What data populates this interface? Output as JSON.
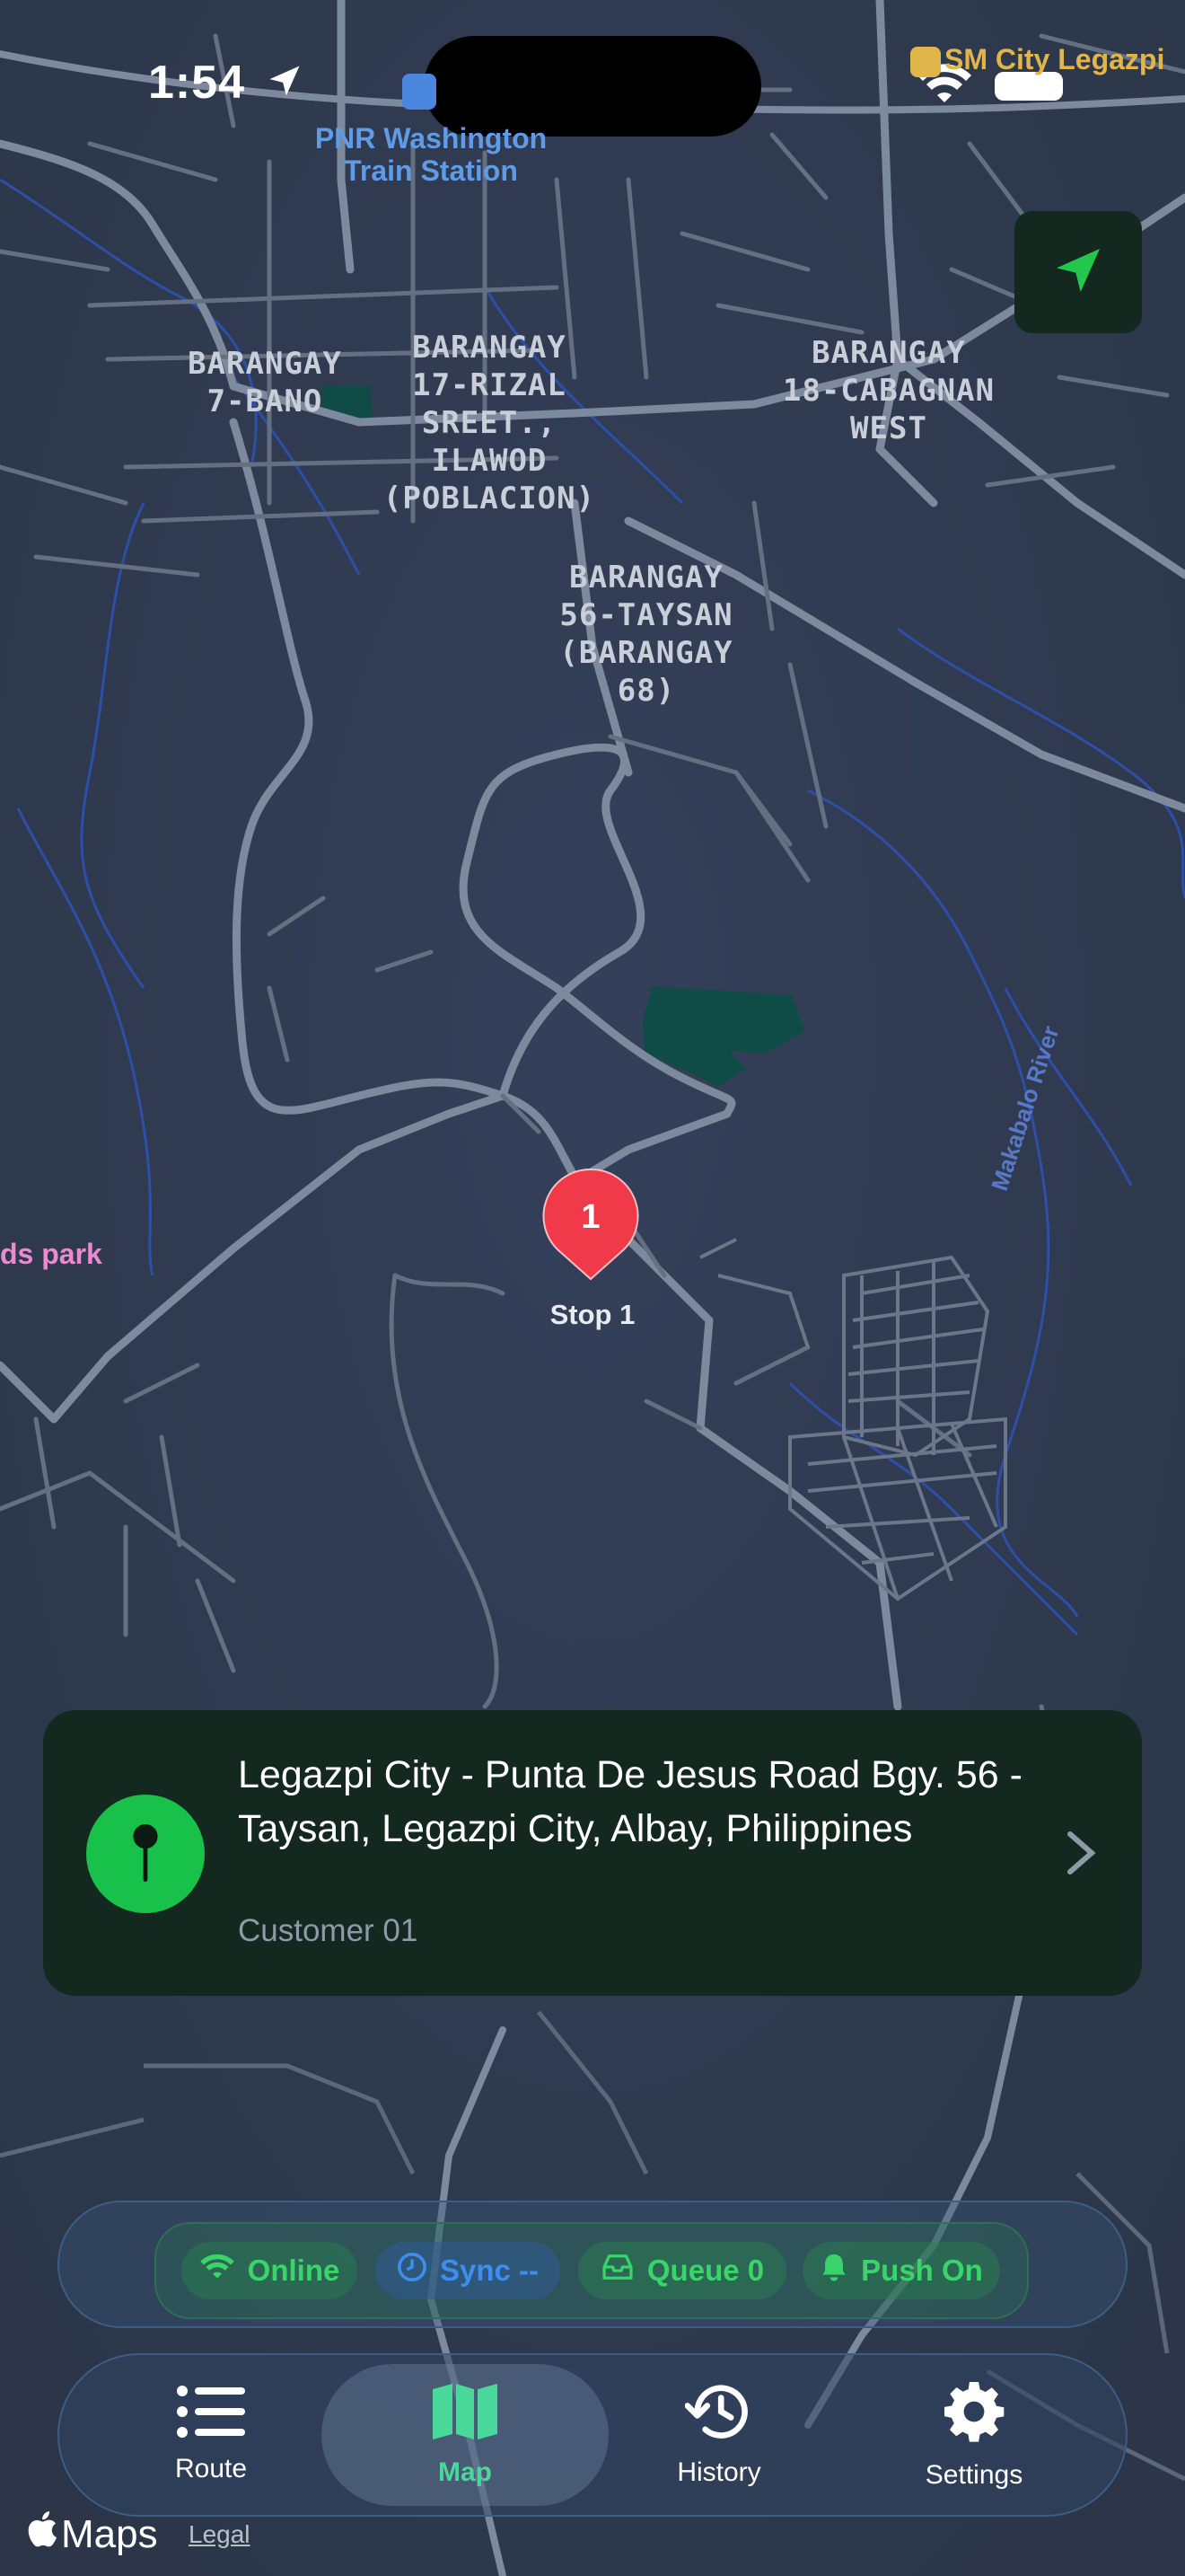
{
  "status": {
    "time": "1:54"
  },
  "map": {
    "labels": {
      "pnr": "PNR Washington Train Station",
      "sm_city": "SM City Legazpi",
      "brgy_7": [
        "BARANGAY",
        "7-BANO"
      ],
      "brgy_17": [
        "BARANGAY",
        "17-RIZAL",
        "SREET.,",
        "ILAWOD",
        "(POBLACION)"
      ],
      "brgy_18": [
        "BARANGAY",
        "18-CABAGNAN",
        "WEST"
      ],
      "brgy_56": [
        "BARANGAY",
        "56-TAYSAN",
        "(BARANGAY",
        "68)"
      ],
      "park": "ds park",
      "river": "Makabalo River"
    },
    "pin": {
      "number": "1",
      "label": "Stop 1"
    },
    "colors": {
      "background": "#2f3a4d",
      "road": "#7d899c",
      "water": "#2d4fa8",
      "park": "#0f4c46",
      "pin": "#f03a4a"
    }
  },
  "card": {
    "title": "Legazpi City - Punta De Jesus Road Bgy. 56 - Taysan, Legazpi City, Albay, Philippines",
    "subtitle": "Customer 01",
    "icon": "map-pin-icon"
  },
  "status_pills": {
    "online": "Online",
    "sync": "Sync --",
    "queue": "Queue 0",
    "push": "Push On"
  },
  "tabs": {
    "route": "Route",
    "map": "Map",
    "history": "History",
    "settings": "Settings",
    "active": "Map"
  },
  "footer": {
    "maps": "Maps",
    "legal": "Legal"
  }
}
